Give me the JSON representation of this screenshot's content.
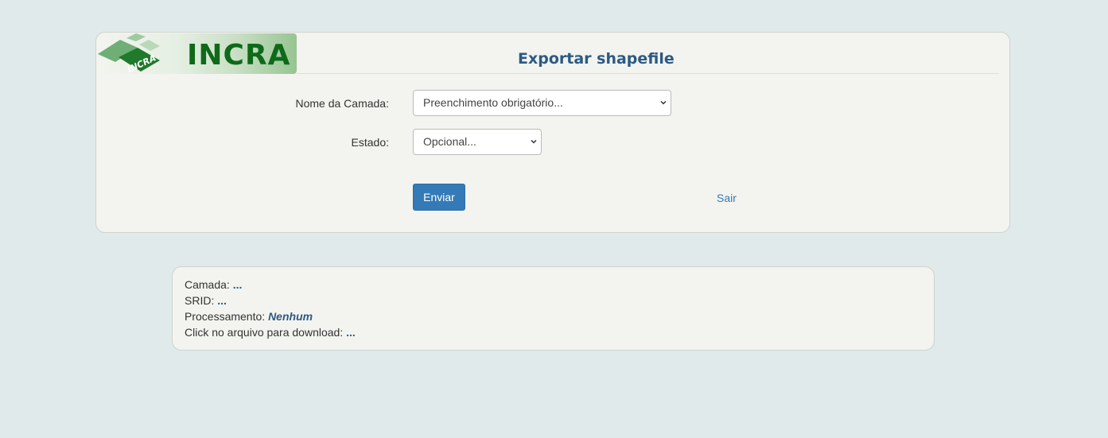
{
  "logo": {
    "text": "INCRA",
    "emblem_text": "INCRA"
  },
  "form": {
    "title": "Exportar shapefile",
    "camada_label": "Nome da Camada:",
    "camada_value": "Preenchimento obrigatório...",
    "estado_label": "Estado:",
    "estado_value": "Opcional...",
    "submit_label": "Enviar",
    "exit_label": "Sair"
  },
  "info": {
    "camada_label": "Camada:",
    "camada_value": "...",
    "srid_label": "SRID:",
    "srid_value": "...",
    "processamento_label": "Processamento:",
    "processamento_value": "Nenhum",
    "download_label": "Click no arquivo para download:",
    "download_value": "..."
  },
  "colors": {
    "background": "#e0eaea",
    "panel": "#f3f4ef",
    "title": "#2c5a85",
    "button": "#337ab7",
    "logo_green": "#0e6a19"
  },
  "icons": {
    "select_arrow": "chevron-down-icon",
    "logo_emblem": "incra-emblem-icon"
  }
}
